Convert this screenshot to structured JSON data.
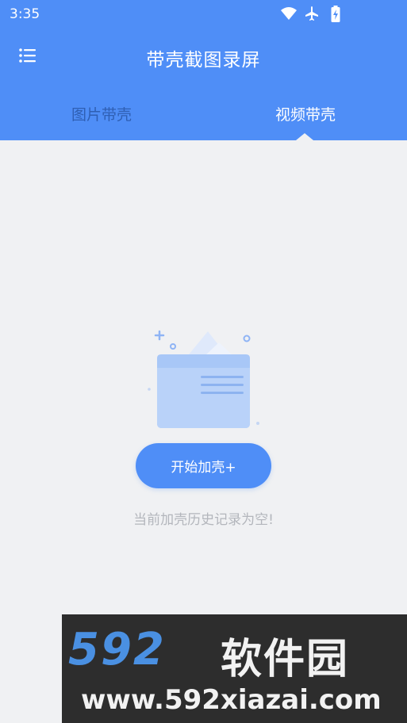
{
  "status_bar": {
    "time": "3:35",
    "icons": [
      "wifi-icon",
      "airplane-icon",
      "battery-charging-icon"
    ]
  },
  "header": {
    "title": "带壳截图录屏",
    "menu_icon": "menu-icon",
    "background": "#4f8ef7"
  },
  "tabs": [
    {
      "label": "图片带壳",
      "selected": false
    },
    {
      "label": "视频带壳",
      "selected": true
    }
  ],
  "empty_state": {
    "illustration": "empty-folder-icon",
    "button_label": "开始加壳+",
    "message": "当前加壳历史记录为空!"
  },
  "watermark": {
    "logo_number": "592",
    "logo_text": "软件园",
    "url": "www.592xiazai.com"
  }
}
